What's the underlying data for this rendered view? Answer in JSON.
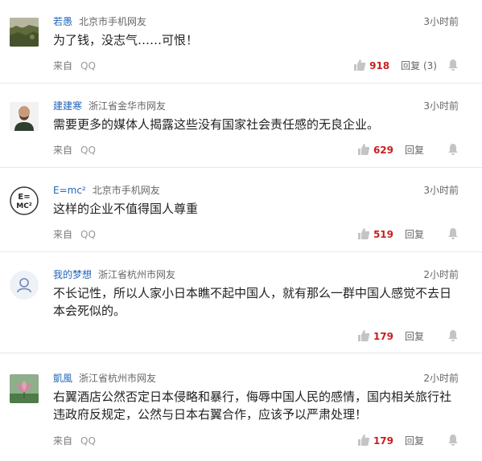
{
  "footer_source_label": "来自",
  "footer_source_app": "QQ",
  "comments": [
    {
      "username": "若愚",
      "location": "北京市手机网友",
      "time": "3小时前",
      "text": "为了钱，没志气……可恨！",
      "likes": "918",
      "reply": "回复 (3)",
      "avatar": "landscape-photo"
    },
    {
      "username": "建建寒",
      "location": "浙江省金华市网友",
      "time": "3小时前",
      "text": "需要更多的媒体人揭露这些没有国家社会责任感的无良企业。",
      "likes": "629",
      "reply": "回复",
      "avatar": "bearded-man-photo"
    },
    {
      "username": "E=mc²",
      "location": "北京市手机网友",
      "time": "3小时前",
      "text": "这样的企业不值得国人尊重",
      "likes": "519",
      "reply": "回复",
      "avatar": "emc2-logo",
      "avatar_text_top": "E=",
      "avatar_text_bottom": "MC²"
    },
    {
      "username": "我的梦想",
      "location": "浙江省杭州市网友",
      "time": "2小时前",
      "text": "不长记性，所以人家小日本瞧不起中国人，就有那么一群中国人感觉不去日本会死似的。",
      "likes": "179",
      "reply": "回复",
      "avatar": "default-user-icon"
    },
    {
      "username": "凱風",
      "location": "浙江省杭州市网友",
      "time": "2小时前",
      "text": "右翼酒店公然否定日本侵略和暴行，侮辱中国人民的感情，国内相关旅行社违政府反规定，公然与日本右翼合作，应该予以严肃处理！",
      "likes": "179",
      "reply": "回复",
      "avatar": "lotus-photo"
    }
  ],
  "colors": {
    "username": "#2266bb",
    "like_count": "#c82020",
    "divider": "#e8e8e8",
    "icon_gray": "#c4c4c4"
  }
}
